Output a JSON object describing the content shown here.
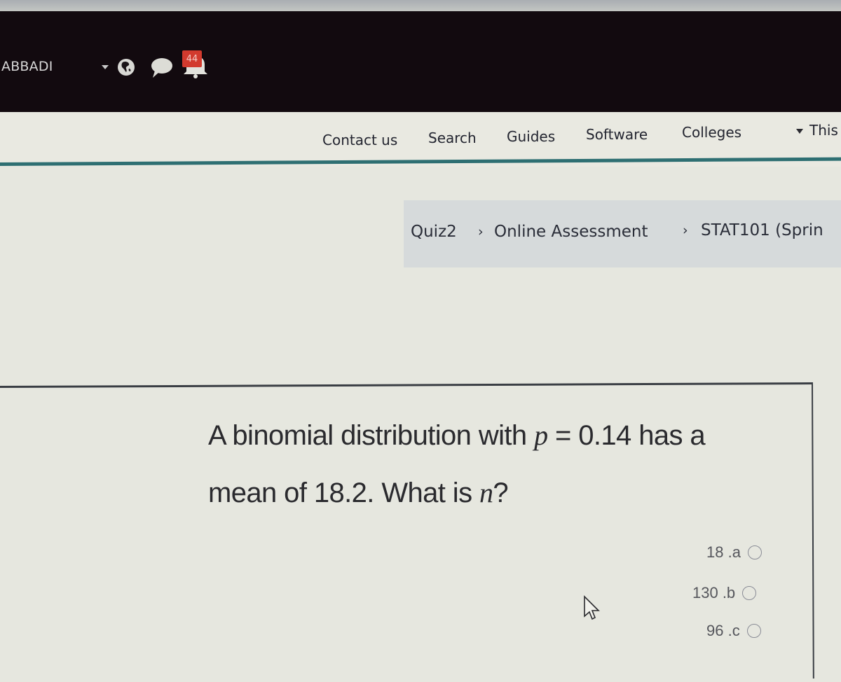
{
  "header": {
    "user_name": "ABBADI",
    "icons": [
      "dropdown-caret-icon",
      "globe-icon",
      "chat-bubble-icon",
      "bell-icon"
    ],
    "notification_count": "44"
  },
  "menu": {
    "items": [
      {
        "label": "Contact us"
      },
      {
        "label": "Search"
      },
      {
        "label": "Guides"
      },
      {
        "label": "Software"
      },
      {
        "label": "Colleges"
      },
      {
        "label": "This"
      }
    ]
  },
  "breadcrumb": {
    "items": [
      {
        "label": "Quiz2"
      },
      {
        "label": "Online Assessment"
      },
      {
        "label": "STAT101 (Sprin"
      }
    ],
    "separator": "›"
  },
  "question": {
    "line1_prefix": "A binomial distribution with ",
    "line1_var": "p",
    "line1_suffix": " = 0.14 has a",
    "line2_prefix": "mean of 18.2. What is ",
    "line2_var": "n",
    "line2_suffix": "?"
  },
  "options": [
    {
      "label": "18 .a",
      "selected": false
    },
    {
      "label": "130 .b",
      "selected": false
    },
    {
      "label": "96 .c",
      "selected": false
    }
  ]
}
